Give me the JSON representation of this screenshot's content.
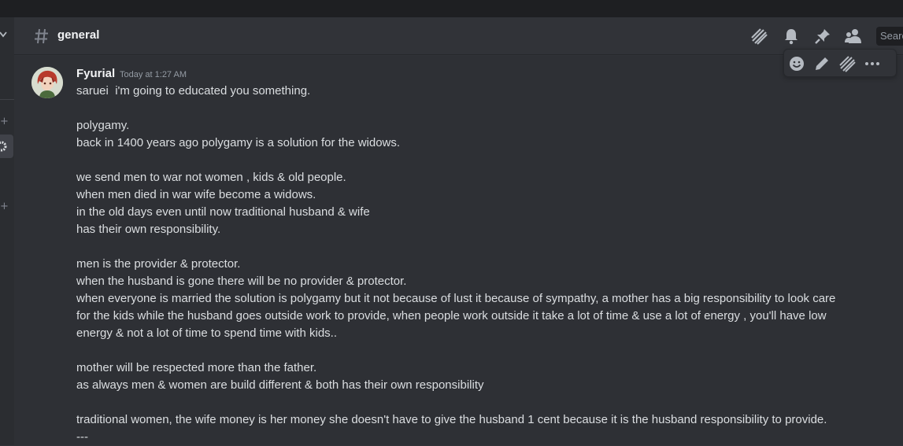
{
  "channel": {
    "name": "general"
  },
  "header": {
    "search_placeholder": "Search",
    "icons": [
      "threads-icon",
      "bell-icon",
      "pin-icon",
      "members-icon"
    ]
  },
  "toolbar": {
    "icons": [
      "emoji-icon",
      "edit-icon",
      "thread-icon",
      "more-icon"
    ]
  },
  "message": {
    "author": "Fyurial",
    "timestamp": "Today at 1:27 AM",
    "lines": [
      "saruei  i'm going to educated you something.",
      "",
      "polygamy.",
      "back in 1400 years ago polygamy is a solution for the widows.",
      "",
      "we send men to war not women , kids & old people.",
      "when men died in war wife become a widows.",
      "in the old days even until now traditional husband & wife",
      "has their own responsibility.",
      "",
      "men is the provider & protector.",
      "when the husband is gone there will be no provider & protector.",
      "when everyone is married the solution is polygamy but it not because of lust it because of sympathy, a mother has a big responsibility to look care",
      "for the kids while the husband goes outside work to provide, when people work outside it take a lot of time & use a lot of energy , you'll have low",
      "energy & not a lot of time to spend time with kids..",
      "",
      "mother will be respected more than the father.",
      "as always men & women are build different & both has their own responsibility",
      "",
      "traditional women, the wife money is her money she doesn't have to give the husband 1 cent because it is the husband responsibility to provide.",
      "---"
    ]
  },
  "colors": {
    "background": "#313338",
    "sidebar": "#2b2d31",
    "topbar": "#1e1f22",
    "text": "#dbdee1",
    "muted": "#949ba4"
  }
}
